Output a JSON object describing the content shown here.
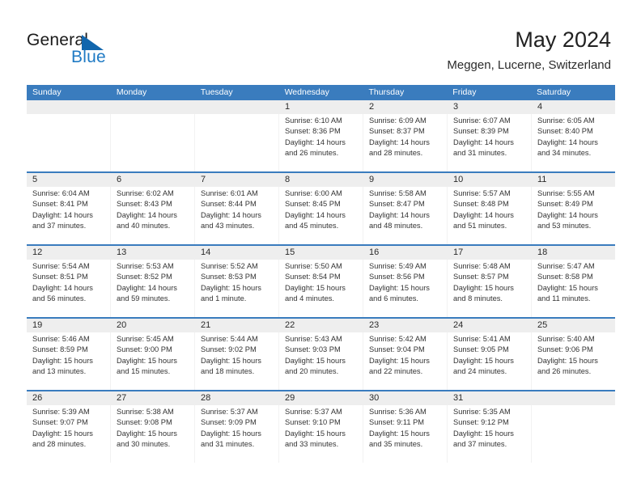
{
  "brand": {
    "name_top": "General",
    "name_bottom": "Blue",
    "flag_icon": "blue-flag-triangle",
    "color_blue": "#1f7ac4"
  },
  "header": {
    "title": "May 2024",
    "subtitle": "Meggen, Lucerne, Switzerland"
  },
  "theme": {
    "header_blue": "#3a7cbe",
    "number_band": "#eeeeee",
    "text": "#333333"
  },
  "calendar": {
    "day_headers": [
      "Sunday",
      "Monday",
      "Tuesday",
      "Wednesday",
      "Thursday",
      "Friday",
      "Saturday"
    ],
    "weeks": [
      [
        {
          "day": "",
          "lines": []
        },
        {
          "day": "",
          "lines": []
        },
        {
          "day": "",
          "lines": []
        },
        {
          "day": "1",
          "lines": [
            "Sunrise: 6:10 AM",
            "Sunset: 8:36 PM",
            "Daylight: 14 hours",
            "and 26 minutes."
          ]
        },
        {
          "day": "2",
          "lines": [
            "Sunrise: 6:09 AM",
            "Sunset: 8:37 PM",
            "Daylight: 14 hours",
            "and 28 minutes."
          ]
        },
        {
          "day": "3",
          "lines": [
            "Sunrise: 6:07 AM",
            "Sunset: 8:39 PM",
            "Daylight: 14 hours",
            "and 31 minutes."
          ]
        },
        {
          "day": "4",
          "lines": [
            "Sunrise: 6:05 AM",
            "Sunset: 8:40 PM",
            "Daylight: 14 hours",
            "and 34 minutes."
          ]
        }
      ],
      [
        {
          "day": "5",
          "lines": [
            "Sunrise: 6:04 AM",
            "Sunset: 8:41 PM",
            "Daylight: 14 hours",
            "and 37 minutes."
          ]
        },
        {
          "day": "6",
          "lines": [
            "Sunrise: 6:02 AM",
            "Sunset: 8:43 PM",
            "Daylight: 14 hours",
            "and 40 minutes."
          ]
        },
        {
          "day": "7",
          "lines": [
            "Sunrise: 6:01 AM",
            "Sunset: 8:44 PM",
            "Daylight: 14 hours",
            "and 43 minutes."
          ]
        },
        {
          "day": "8",
          "lines": [
            "Sunrise: 6:00 AM",
            "Sunset: 8:45 PM",
            "Daylight: 14 hours",
            "and 45 minutes."
          ]
        },
        {
          "day": "9",
          "lines": [
            "Sunrise: 5:58 AM",
            "Sunset: 8:47 PM",
            "Daylight: 14 hours",
            "and 48 minutes."
          ]
        },
        {
          "day": "10",
          "lines": [
            "Sunrise: 5:57 AM",
            "Sunset: 8:48 PM",
            "Daylight: 14 hours",
            "and 51 minutes."
          ]
        },
        {
          "day": "11",
          "lines": [
            "Sunrise: 5:55 AM",
            "Sunset: 8:49 PM",
            "Daylight: 14 hours",
            "and 53 minutes."
          ]
        }
      ],
      [
        {
          "day": "12",
          "lines": [
            "Sunrise: 5:54 AM",
            "Sunset: 8:51 PM",
            "Daylight: 14 hours",
            "and 56 minutes."
          ]
        },
        {
          "day": "13",
          "lines": [
            "Sunrise: 5:53 AM",
            "Sunset: 8:52 PM",
            "Daylight: 14 hours",
            "and 59 minutes."
          ]
        },
        {
          "day": "14",
          "lines": [
            "Sunrise: 5:52 AM",
            "Sunset: 8:53 PM",
            "Daylight: 15 hours",
            "and 1 minute."
          ]
        },
        {
          "day": "15",
          "lines": [
            "Sunrise: 5:50 AM",
            "Sunset: 8:54 PM",
            "Daylight: 15 hours",
            "and 4 minutes."
          ]
        },
        {
          "day": "16",
          "lines": [
            "Sunrise: 5:49 AM",
            "Sunset: 8:56 PM",
            "Daylight: 15 hours",
            "and 6 minutes."
          ]
        },
        {
          "day": "17",
          "lines": [
            "Sunrise: 5:48 AM",
            "Sunset: 8:57 PM",
            "Daylight: 15 hours",
            "and 8 minutes."
          ]
        },
        {
          "day": "18",
          "lines": [
            "Sunrise: 5:47 AM",
            "Sunset: 8:58 PM",
            "Daylight: 15 hours",
            "and 11 minutes."
          ]
        }
      ],
      [
        {
          "day": "19",
          "lines": [
            "Sunrise: 5:46 AM",
            "Sunset: 8:59 PM",
            "Daylight: 15 hours",
            "and 13 minutes."
          ]
        },
        {
          "day": "20",
          "lines": [
            "Sunrise: 5:45 AM",
            "Sunset: 9:00 PM",
            "Daylight: 15 hours",
            "and 15 minutes."
          ]
        },
        {
          "day": "21",
          "lines": [
            "Sunrise: 5:44 AM",
            "Sunset: 9:02 PM",
            "Daylight: 15 hours",
            "and 18 minutes."
          ]
        },
        {
          "day": "22",
          "lines": [
            "Sunrise: 5:43 AM",
            "Sunset: 9:03 PM",
            "Daylight: 15 hours",
            "and 20 minutes."
          ]
        },
        {
          "day": "23",
          "lines": [
            "Sunrise: 5:42 AM",
            "Sunset: 9:04 PM",
            "Daylight: 15 hours",
            "and 22 minutes."
          ]
        },
        {
          "day": "24",
          "lines": [
            "Sunrise: 5:41 AM",
            "Sunset: 9:05 PM",
            "Daylight: 15 hours",
            "and 24 minutes."
          ]
        },
        {
          "day": "25",
          "lines": [
            "Sunrise: 5:40 AM",
            "Sunset: 9:06 PM",
            "Daylight: 15 hours",
            "and 26 minutes."
          ]
        }
      ],
      [
        {
          "day": "26",
          "lines": [
            "Sunrise: 5:39 AM",
            "Sunset: 9:07 PM",
            "Daylight: 15 hours",
            "and 28 minutes."
          ]
        },
        {
          "day": "27",
          "lines": [
            "Sunrise: 5:38 AM",
            "Sunset: 9:08 PM",
            "Daylight: 15 hours",
            "and 30 minutes."
          ]
        },
        {
          "day": "28",
          "lines": [
            "Sunrise: 5:37 AM",
            "Sunset: 9:09 PM",
            "Daylight: 15 hours",
            "and 31 minutes."
          ]
        },
        {
          "day": "29",
          "lines": [
            "Sunrise: 5:37 AM",
            "Sunset: 9:10 PM",
            "Daylight: 15 hours",
            "and 33 minutes."
          ]
        },
        {
          "day": "30",
          "lines": [
            "Sunrise: 5:36 AM",
            "Sunset: 9:11 PM",
            "Daylight: 15 hours",
            "and 35 minutes."
          ]
        },
        {
          "day": "31",
          "lines": [
            "Sunrise: 5:35 AM",
            "Sunset: 9:12 PM",
            "Daylight: 15 hours",
            "and 37 minutes."
          ]
        },
        {
          "day": "",
          "lines": []
        }
      ]
    ]
  }
}
